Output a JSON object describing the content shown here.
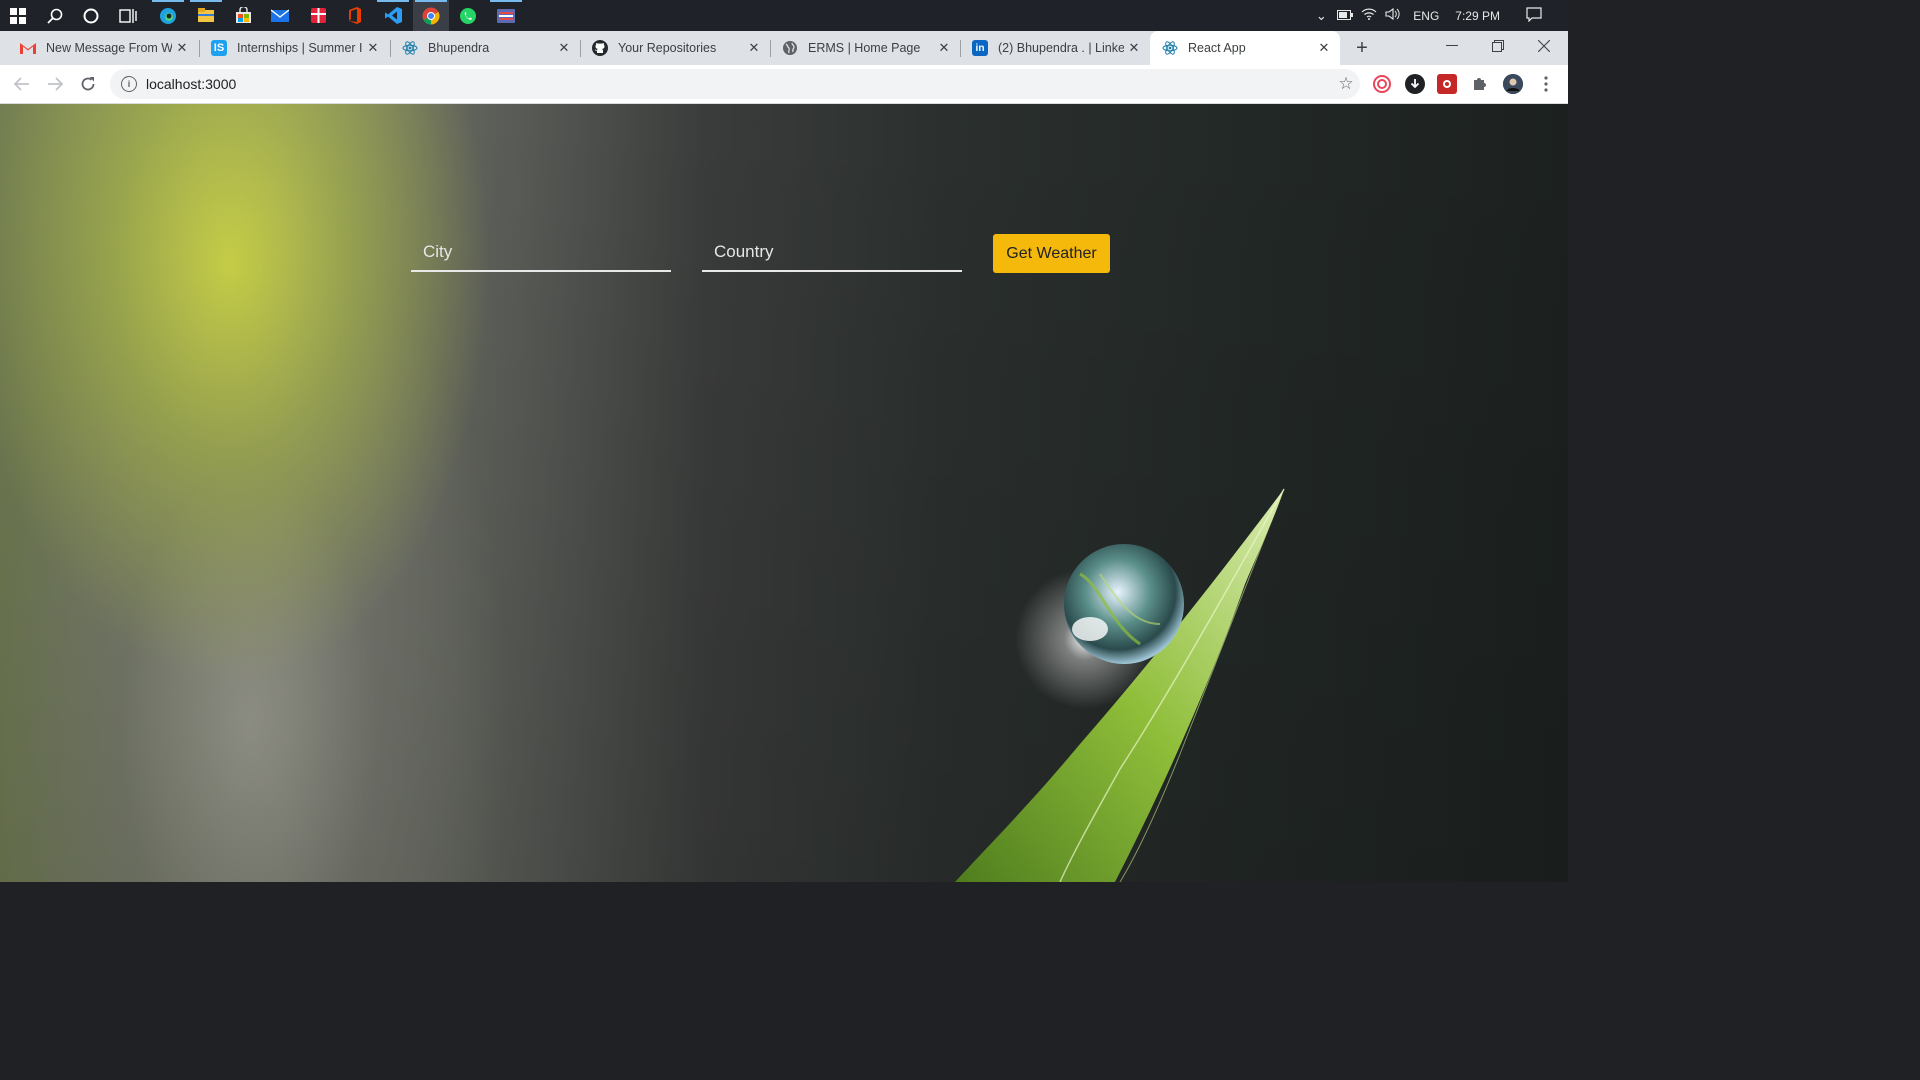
{
  "taskbar": {
    "icons": [
      "windows-start-icon",
      "search-icon",
      "cortana-icon",
      "task-view-icon",
      "edge-icon",
      "file-explorer-icon",
      "store-icon",
      "mail-icon",
      "gift-app-icon",
      "office-icon",
      "vscode-icon",
      "chrome-icon",
      "whatsapp-icon",
      "flag-app-icon"
    ],
    "language": "ENG",
    "time": "7:29 PM"
  },
  "tabs": [
    {
      "title": "New Message From W",
      "favicon": "gmail-icon"
    },
    {
      "title": "Internships | Summer In",
      "favicon": "internshala-icon",
      "favicon_text": "IS"
    },
    {
      "title": "Bhupendra",
      "favicon": "react-icon"
    },
    {
      "title": "Your Repositories",
      "favicon": "github-icon"
    },
    {
      "title": "ERMS | Home Page",
      "favicon": "globe-icon"
    },
    {
      "title": "(2) Bhupendra . | Linked",
      "favicon": "linkedin-icon",
      "favicon_text": "in"
    },
    {
      "title": "React App",
      "favicon": "react-icon",
      "active": true
    }
  ],
  "address_bar": {
    "url": "localhost:3000"
  },
  "form": {
    "city_placeholder": "City",
    "country_placeholder": "Country",
    "submit_label": "Get Weather"
  },
  "colors": {
    "accent_button": "#f5b90c",
    "taskbar": "#1f2329",
    "tabstrip": "#dee1e6"
  }
}
